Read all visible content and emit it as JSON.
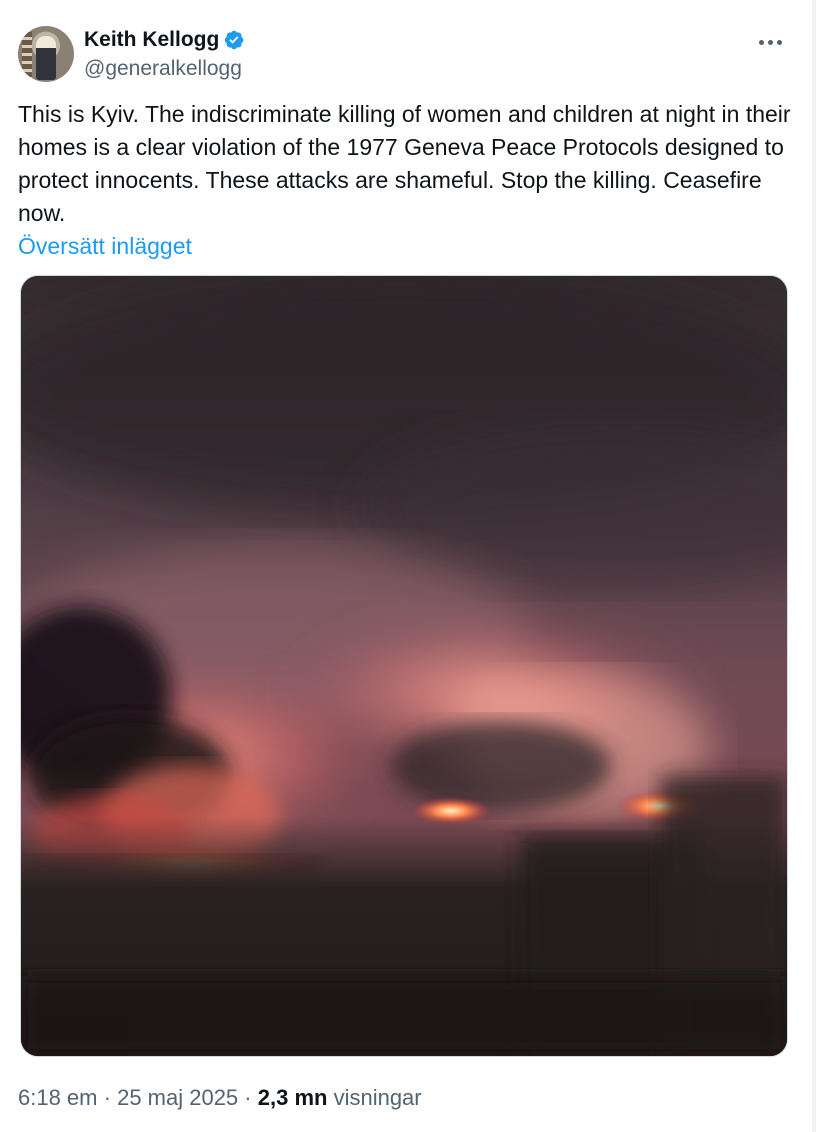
{
  "author": {
    "display_name": "Keith Kellogg",
    "handle": "@generalkellogg",
    "verified": true,
    "verified_color": "#1d9bf0"
  },
  "tweet": {
    "text": "This is Kyiv. The indiscriminate killing of women and children at night in their homes is a clear violation of the 1977 Geneva Peace Protocols designed to protect innocents. These attacks are shameful. Stop the killing. Ceasefire now.",
    "translate_label": "Översätt inlägget"
  },
  "media": {
    "description_icon": "photo"
  },
  "meta": {
    "time": "6:18 em",
    "separator": "·",
    "date": "25 maj 2025",
    "views_count": "2,3 mn",
    "views_label": "visningar"
  },
  "colors": {
    "text": "#0f1419",
    "secondary": "#536471",
    "link": "#1d9bf0",
    "border": "#cfd9de"
  }
}
